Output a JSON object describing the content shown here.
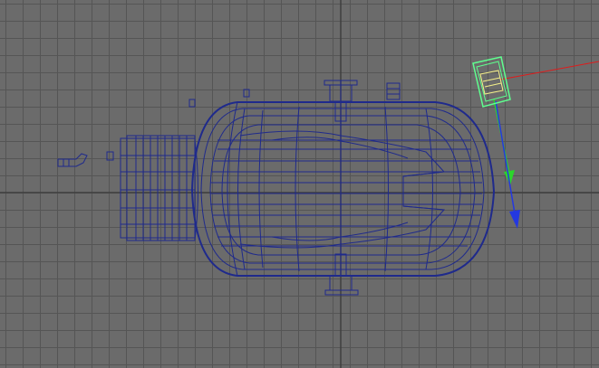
{
  "viewport": {
    "background_color": "#6b6b6b",
    "grid_line_color": "#555555",
    "grid_axis_color": "#333333"
  },
  "model": {
    "wireframe_color": "#1f2a8c",
    "object": "wireframe-tank"
  },
  "selection": {
    "highlight_color": "#5fff8f",
    "inner_color": "#f5f08a"
  },
  "manipulator": {
    "x_axis_color": "#e01b1b",
    "y_axis_color": "#2bd62b",
    "z_axis_color": "#2438e0"
  }
}
